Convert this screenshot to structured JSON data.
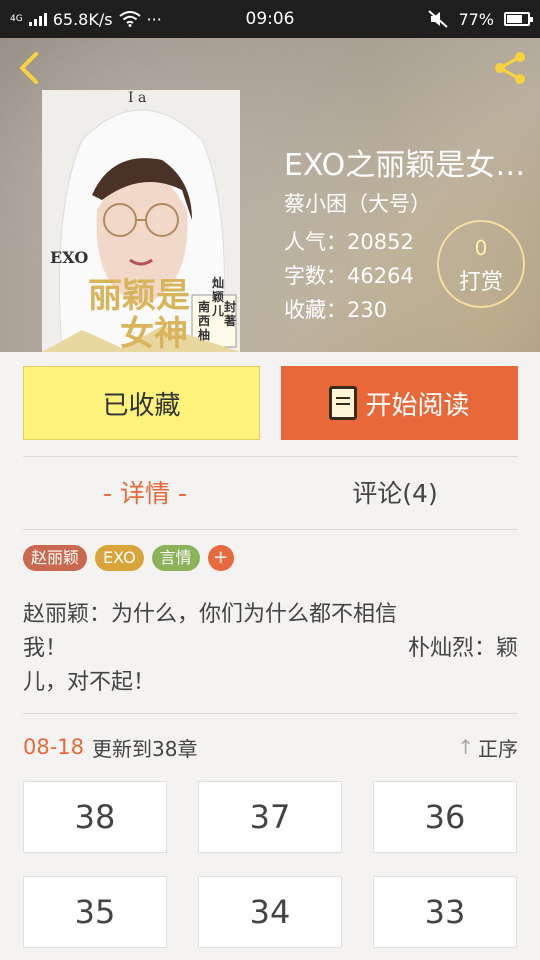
{
  "statusbar": {
    "network": "4G",
    "speed": "65.8K/s",
    "dots": "···",
    "time": "09:06",
    "battery": "77%",
    "battery_level": 0.77
  },
  "book": {
    "title": "EXO之丽颖是女…",
    "author": "蔡小困（大号）",
    "popularity": "人气：20852",
    "word_count": "字数：46264",
    "favorites": "收藏：230",
    "tip_count": "0",
    "tip_label": "打赏"
  },
  "cover": {
    "top_text": "I a",
    "exo": "EXO",
    "title_line1": "丽颖是",
    "title_line2": "女神",
    "author_col1": "灿颖儿",
    "author_col2": "南西柚",
    "author_col3": "封著"
  },
  "actions": {
    "collected_label": "已收藏",
    "read_label": "开始阅读"
  },
  "tabs": {
    "details": "- 详情 -",
    "comments": "评论(4)"
  },
  "tags": [
    {
      "label": "赵丽颖",
      "color": "#c8694f"
    },
    {
      "label": "EXO",
      "color": "#d9a53a"
    },
    {
      "label": "言情",
      "color": "#8bb45a"
    },
    {
      "label": "+",
      "color": "#e8693b"
    }
  ],
  "description": {
    "line1": "赵丽颖：为什么，你们为什么都不相信",
    "line2a": "我！",
    "line2b": "朴灿烈：颖",
    "line3": "儿，对不起！"
  },
  "updates": {
    "date": "08-18",
    "text": "更新到38章",
    "sort_label": "正序",
    "sort_arrow": "↑"
  },
  "chapters": [
    "38",
    "37",
    "36",
    "35",
    "34",
    "33"
  ],
  "colors": {
    "accent": "#e8693b",
    "collected_bg": "#fcf27c"
  }
}
